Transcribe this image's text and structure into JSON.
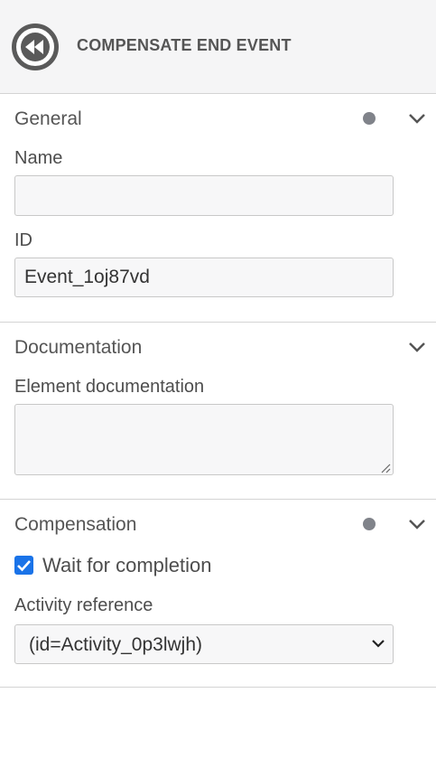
{
  "header": {
    "title": "COMPENSATE END EVENT",
    "icon": "compensate-end-event-icon"
  },
  "general": {
    "title": "General",
    "name_label": "Name",
    "name_value": "",
    "id_label": "ID",
    "id_value": "Event_1oj87vd"
  },
  "documentation": {
    "title": "Documentation",
    "doc_label": "Element documentation",
    "doc_value": ""
  },
  "compensation": {
    "title": "Compensation",
    "wait_label": "Wait for completion",
    "wait_checked": true,
    "activity_label": "Activity reference",
    "activity_value": "(id=Activity_0p3lwjh)"
  },
  "colors": {
    "accent": "#1a73e8",
    "header_bg": "#f5f5f6",
    "dot": "#80838a"
  }
}
